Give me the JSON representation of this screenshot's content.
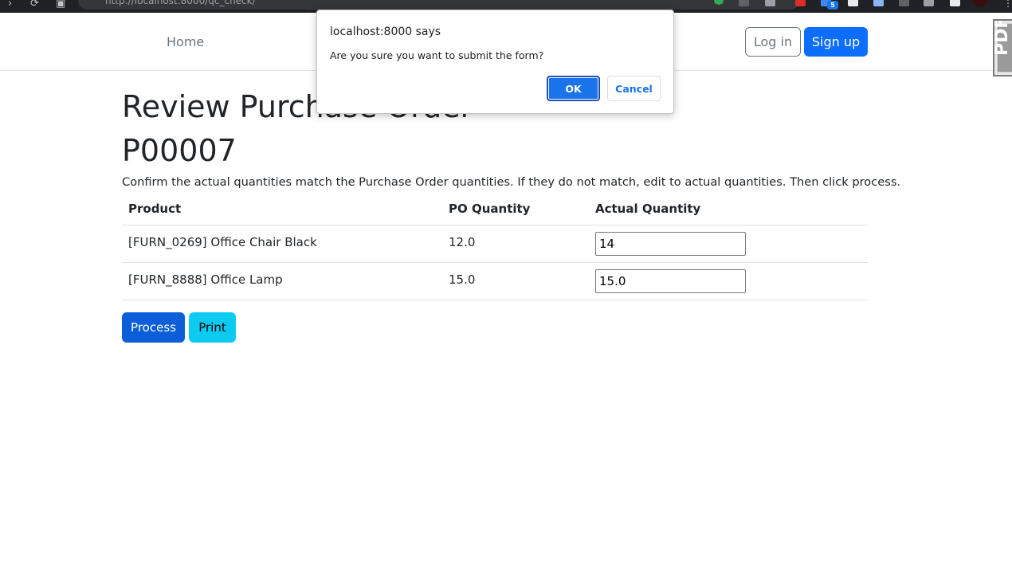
{
  "browser": {
    "url": "http://localhost:8000/qc_check/",
    "extension_badge": "5"
  },
  "navbar": {
    "home_label": "Home",
    "login_label": "Log in",
    "signup_label": "Sign up",
    "side_logo_text": "PDF"
  },
  "page": {
    "title": "Review Purchase Order P00007",
    "instructions": "Confirm the actual quantities match the Purchase Order quantities. If they do not match, edit to actual quantities. Then click process."
  },
  "table": {
    "headers": [
      "Product",
      "PO Quantity",
      "Actual Quantity"
    ],
    "rows": [
      {
        "product": "[FURN_0269] Office Chair Black",
        "po_quantity": "12.0",
        "actual_quantity": "14"
      },
      {
        "product": "[FURN_8888] Office Lamp",
        "po_quantity": "15.0",
        "actual_quantity": "15.0"
      }
    ]
  },
  "actions": {
    "process_label": "Process",
    "print_label": "Print"
  },
  "dialog": {
    "title": "localhost:8000 says",
    "message": "Are you sure you want to submit the form?",
    "ok_label": "OK",
    "cancel_label": "Cancel"
  },
  "colors": {
    "primary": "#0d6efd",
    "process": "#0b5ed7",
    "info": "#0dcaf0",
    "dialog_accent": "#1a73e8",
    "browser_chrome": "#202124"
  }
}
